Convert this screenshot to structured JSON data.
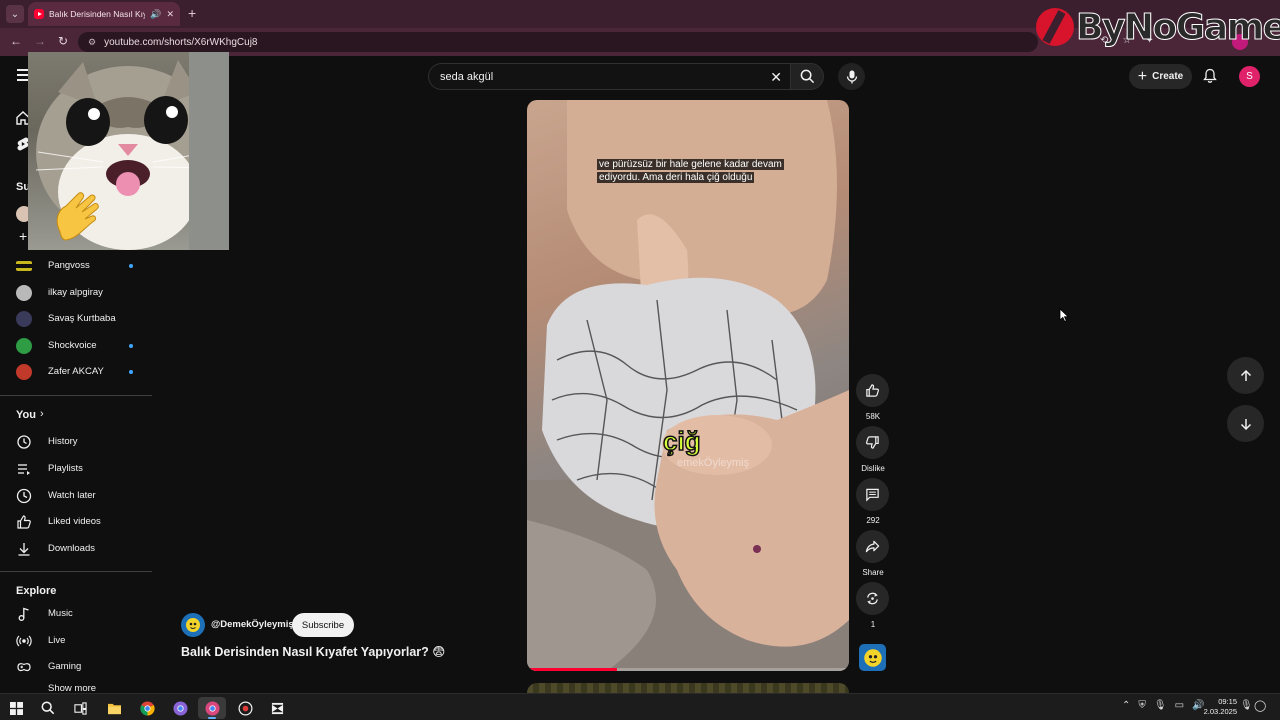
{
  "browser": {
    "tab_title": "Balık Derisinden Nasıl Kıyafet Yapıyorlar? - YouTube",
    "url": "youtube.com/shorts/X6rWKhgCuj8"
  },
  "watermark": {
    "text": "ByNoGame"
  },
  "search": {
    "value": "seda akgül"
  },
  "header": {
    "create_label": "Create",
    "avatar_letter": "S"
  },
  "sidebar": {
    "subscriptions_label": "Su",
    "channels": [
      {
        "name": "Pangvoss",
        "avatar_color": "#c7b91b",
        "new": true
      },
      {
        "name": "ilkay alpgiray",
        "avatar_color": "#b9b9b9",
        "new": false
      },
      {
        "name": "Savaş Kurtbaba",
        "avatar_color": "#3a3a5a",
        "new": false
      },
      {
        "name": "Shockvoice",
        "avatar_color": "#2e9b45",
        "new": true
      },
      {
        "name": "Zafer AKCAY",
        "avatar_color": "#c0392b",
        "new": true
      }
    ],
    "you_label": "You",
    "you_items": [
      "History",
      "Playlists",
      "Watch later",
      "Liked videos",
      "Downloads"
    ],
    "explore_label": "Explore",
    "explore_items": [
      "Music",
      "Live",
      "Gaming"
    ],
    "show_more": "Show more"
  },
  "short": {
    "caption_line1": "ve pürüzsüz bir hale gelene kadar devam",
    "caption_line2": "ediyordu. Ama deri hala çiğ olduğu",
    "big_word": "çiğ",
    "watermark_text": "emekÖyleymiş",
    "progress": 0.28,
    "channel_handle": "@DemekÖyleymiş",
    "subscribe_label": "Subscribe",
    "title": "Balık Derisinden Nasıl Kıyafet Yapıyorlar? 😨"
  },
  "actions": {
    "likes": "58K",
    "dislike_label": "Dislike",
    "comments": "292",
    "share_label": "Share",
    "remix_count": "1"
  },
  "taskbar": {
    "time": "09:15",
    "date": "2.03.2025"
  },
  "colors": {
    "accent_red": "#ff0033",
    "background": "#0f0f0f",
    "tab_strip": "#3c1f2e"
  }
}
